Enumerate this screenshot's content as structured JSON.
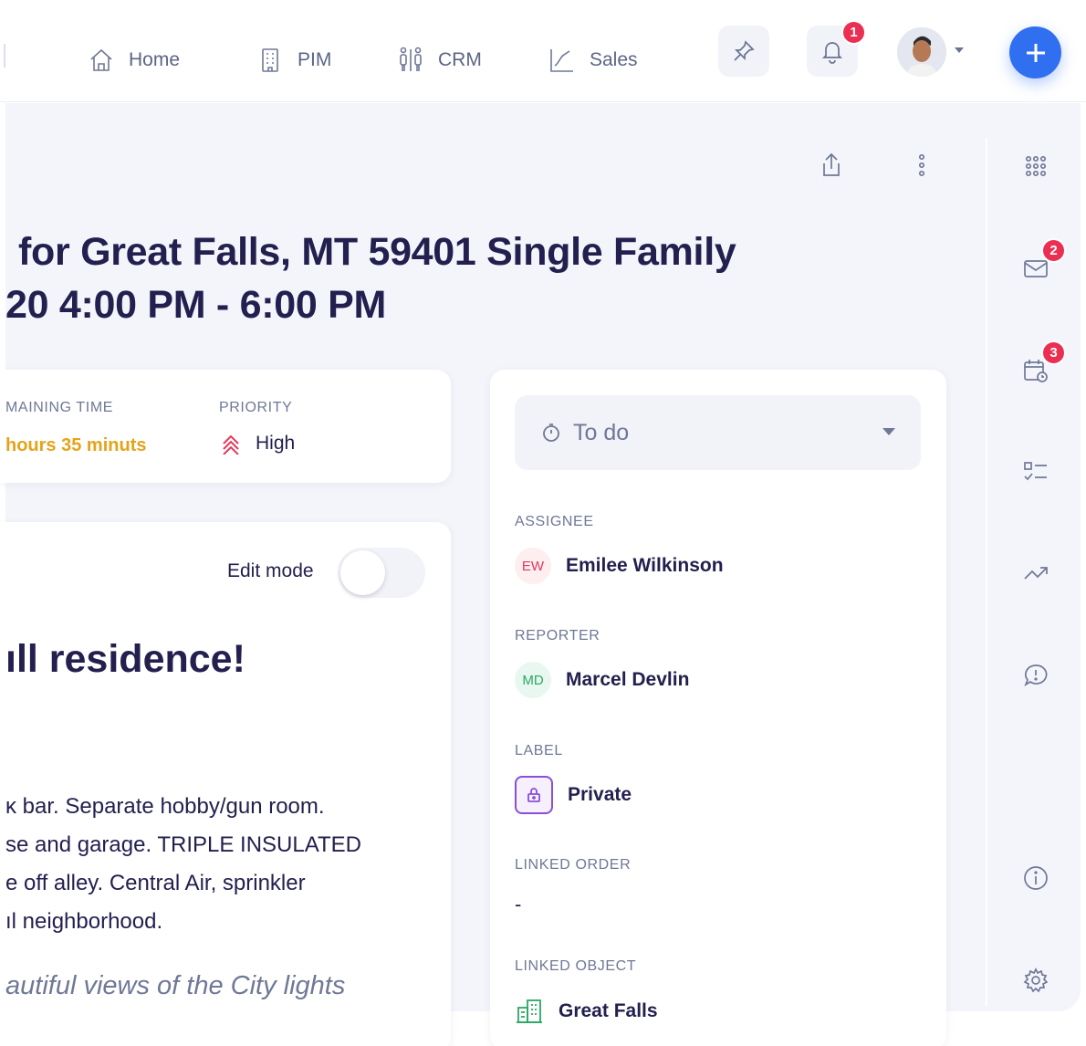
{
  "nav": {
    "home_label": "Home",
    "pim_label": "PIM",
    "crm_label": "CRM",
    "sales_label": "Sales",
    "notification_count": "1"
  },
  "task": {
    "title_line1": "for Great Falls, MT 59401 Single Family",
    "title_line2": "20 4:00 PM - 6:00 PM",
    "remaining_time_label": "MAINING TIME",
    "remaining_time_value": "hours 35 minuts",
    "priority_label": "PRIORITY",
    "priority_value": "High",
    "edit_mode_label": "Edit mode",
    "edit_mode_on": false,
    "heading": "ıll residence!",
    "description_lines": [
      "ᴋ bar. Separate hobby/gun room.",
      "se and garage. TRIPLE INSULATED",
      "e off alley. Central Air, sprinkler",
      "ıl neighborhood."
    ],
    "italic_line": "autiful views of the City lights"
  },
  "details": {
    "status": "To do",
    "assignee_label": "ASSIGNEE",
    "assignee_initials": "EW",
    "assignee_name": "Emilee Wilkinson",
    "reporter_label": "REPORTER",
    "reporter_initials": "MD",
    "reporter_name": "Marcel Devlin",
    "label_label": "LABEL",
    "label_value": "Private",
    "linked_order_label": "LINKED ORDER",
    "linked_order_value": "-",
    "linked_object_label": "LINKED OBJECT",
    "linked_object_value": "Great Falls"
  },
  "rail": {
    "mail_count": "2",
    "calendar_count": "3"
  },
  "colors": {
    "accent": "#2f6ff0",
    "badge": "#ea2f52",
    "remaining_time": "#e4a31a",
    "priority_high": "#e2385a",
    "label_private": "#8a4ed8",
    "linked_object": "#2aa864"
  }
}
